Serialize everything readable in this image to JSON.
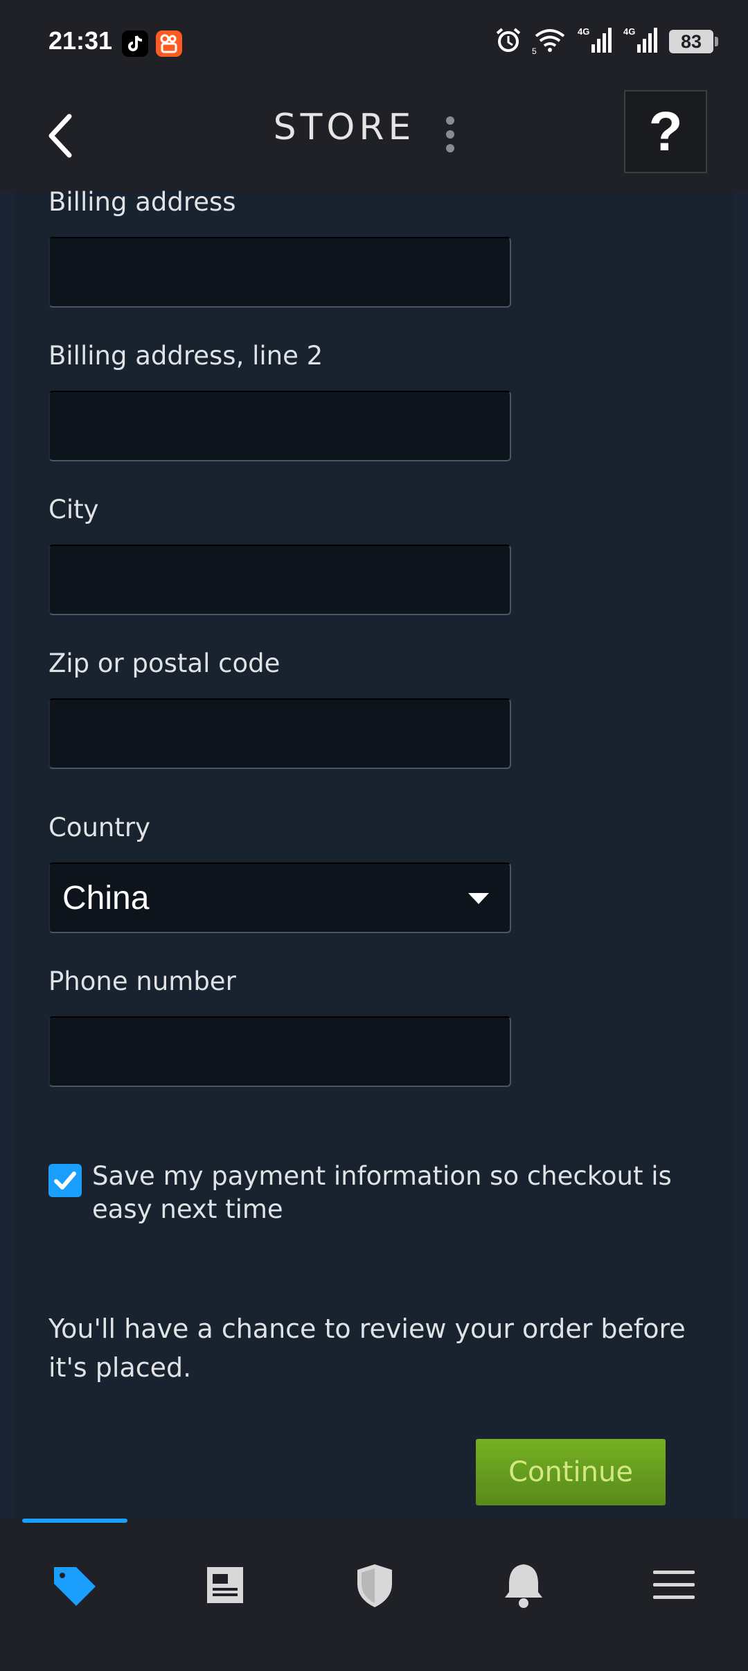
{
  "status_bar": {
    "time": "21:31",
    "battery": "83",
    "icons": [
      "tiktok-icon",
      "kuaishou-icon",
      "alarm-icon",
      "wifi-icon",
      "signal-4g-icon",
      "signal-4g-icon",
      "battery-icon"
    ],
    "network_label": "4G",
    "wifi_badge": "5"
  },
  "header": {
    "title": "STORE",
    "help_label": "?"
  },
  "form": {
    "billing_address_label": "Billing address",
    "billing_address_value": "",
    "billing_address_2_label": "Billing address, line 2",
    "billing_address_2_value": "",
    "city_label": "City",
    "city_value": "",
    "zip_label": "Zip or postal code",
    "zip_value": "",
    "country_label": "Country",
    "country_value": "China",
    "phone_label": "Phone number",
    "phone_value": ""
  },
  "save_payment": {
    "checked": true,
    "label": "Save my payment information so checkout is easy next time"
  },
  "review_note": "You'll have a chance to review your order before it's placed.",
  "continue_label": "Continue",
  "bottom_nav": {
    "items": [
      "store-tag-icon",
      "news-icon",
      "guard-shield-icon",
      "notifications-bell-icon",
      "menu-icon"
    ],
    "active": "store-tag-icon"
  },
  "colors": {
    "accent": "#1a9fff",
    "continue_green": "#75b022",
    "background": "#19222f"
  }
}
